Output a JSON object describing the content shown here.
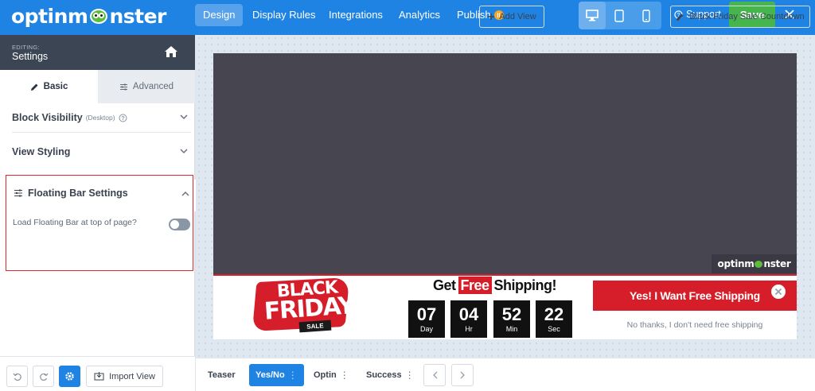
{
  "brand": {
    "logo_pre": "optinm",
    "logo_post": "nster"
  },
  "nav": {
    "tabs": [
      {
        "label": "Design",
        "active": true
      },
      {
        "label": "Display Rules"
      },
      {
        "label": "Integrations"
      },
      {
        "label": "Analytics"
      },
      {
        "label": "Publish"
      }
    ],
    "support_label": "Support",
    "save_label": "Save",
    "devices": [
      "desktop-icon",
      "tablet-icon",
      "mobile-icon"
    ]
  },
  "sidebar": {
    "editing_small": "EDITING:",
    "editing_title": "Settings",
    "tabs": {
      "basic": "Basic",
      "advanced": "Advanced"
    },
    "sections": [
      {
        "label": "Block Visibility",
        "sub": "(Desktop)"
      },
      {
        "label": "View Styling"
      },
      {
        "label": "Floating Bar Settings"
      }
    ],
    "floating_bar": {
      "toggle_label": "Load Floating Bar at top of page?",
      "enabled": false
    },
    "import_label": "Import View"
  },
  "preview": {
    "watermark_pre": "optinm",
    "watermark_post": "nster",
    "bf": {
      "line1": "BLACK",
      "line2": "FRIDAY",
      "line3": "SALE"
    },
    "shipping": {
      "pre": "Get",
      "highlight": "Free",
      "post": "Shipping!"
    },
    "countdown": [
      {
        "value": "07",
        "unit": "Day"
      },
      {
        "value": "04",
        "unit": "Hr"
      },
      {
        "value": "52",
        "unit": "Min"
      },
      {
        "value": "22",
        "unit": "Sec"
      }
    ],
    "cta_label": "Yes! I Want Free Shipping",
    "no_thanks": "No thanks, I don't need free shipping",
    "colors": {
      "accent": "#d51e29",
      "dark": "#464550"
    }
  },
  "bottom": {
    "views": [
      {
        "label": "Teaser",
        "active": false
      },
      {
        "label": "Yes/No",
        "active": true
      },
      {
        "label": "Optin",
        "active": false
      },
      {
        "label": "Success",
        "active": false
      }
    ],
    "add_view": "Add View",
    "campaign_name": "Black Friday Sale Countdown"
  },
  "colors": {
    "primary": "#1f83e4",
    "save": "#47b54e",
    "sidebar_head": "#3b4553"
  }
}
